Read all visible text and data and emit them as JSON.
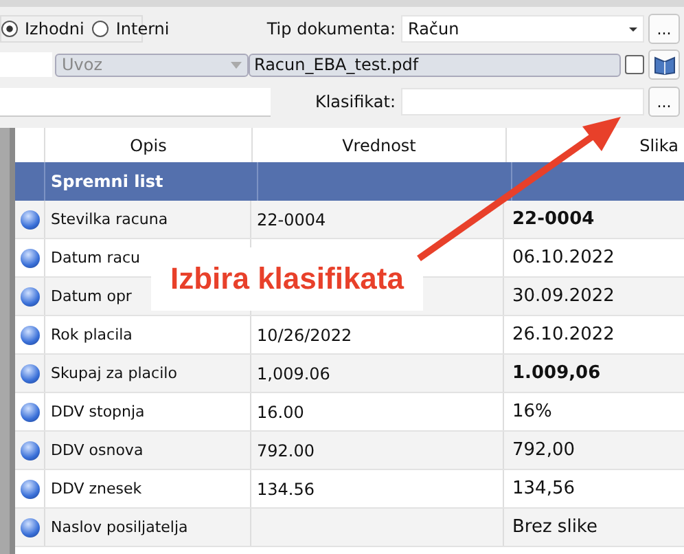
{
  "direction_radios": [
    {
      "label": "Izhodni",
      "selected": true
    },
    {
      "label": "Interni",
      "selected": false
    }
  ],
  "document_type": {
    "label": "Tip dokumenta:",
    "value": "Račun",
    "browse_button": "..."
  },
  "source": {
    "value": "Uvoz"
  },
  "file": {
    "value": "Racun_EBA_test.pdf",
    "checked": false
  },
  "classification": {
    "label": "Klasifikat:",
    "browse_button": "..."
  },
  "table": {
    "columns": [
      "Opis",
      "Vrednost",
      "Slika"
    ],
    "section": "Spremni list",
    "rows": [
      {
        "description": "Stevilka racuna",
        "value": "22-0004",
        "image": "22-0004",
        "bold": true
      },
      {
        "description": "Datum racu",
        "value": "",
        "image": "06.10.2022",
        "bold": false
      },
      {
        "description": "Datum opr",
        "value": "",
        "image": "30.09.2022",
        "bold": false
      },
      {
        "description": "Rok placila",
        "value": "10/26/2022",
        "image": "26.10.2022",
        "bold": false
      },
      {
        "description": "Skupaj za placilo",
        "value": "1,009.06",
        "image": "1.009,06",
        "bold": true
      },
      {
        "description": "DDV stopnja",
        "value": "16.00",
        "image": "16%",
        "bold": false
      },
      {
        "description": "DDV osnova",
        "value": "792.00",
        "image": "792,00",
        "bold": false
      },
      {
        "description": "DDV znesek",
        "value": "134.56",
        "image": "134,56",
        "bold": false
      },
      {
        "description": "Naslov posiljatelja",
        "value": "",
        "image": "Brez slike",
        "bold": false
      }
    ]
  },
  "annotation": {
    "text": "Izbira klasifikata"
  }
}
